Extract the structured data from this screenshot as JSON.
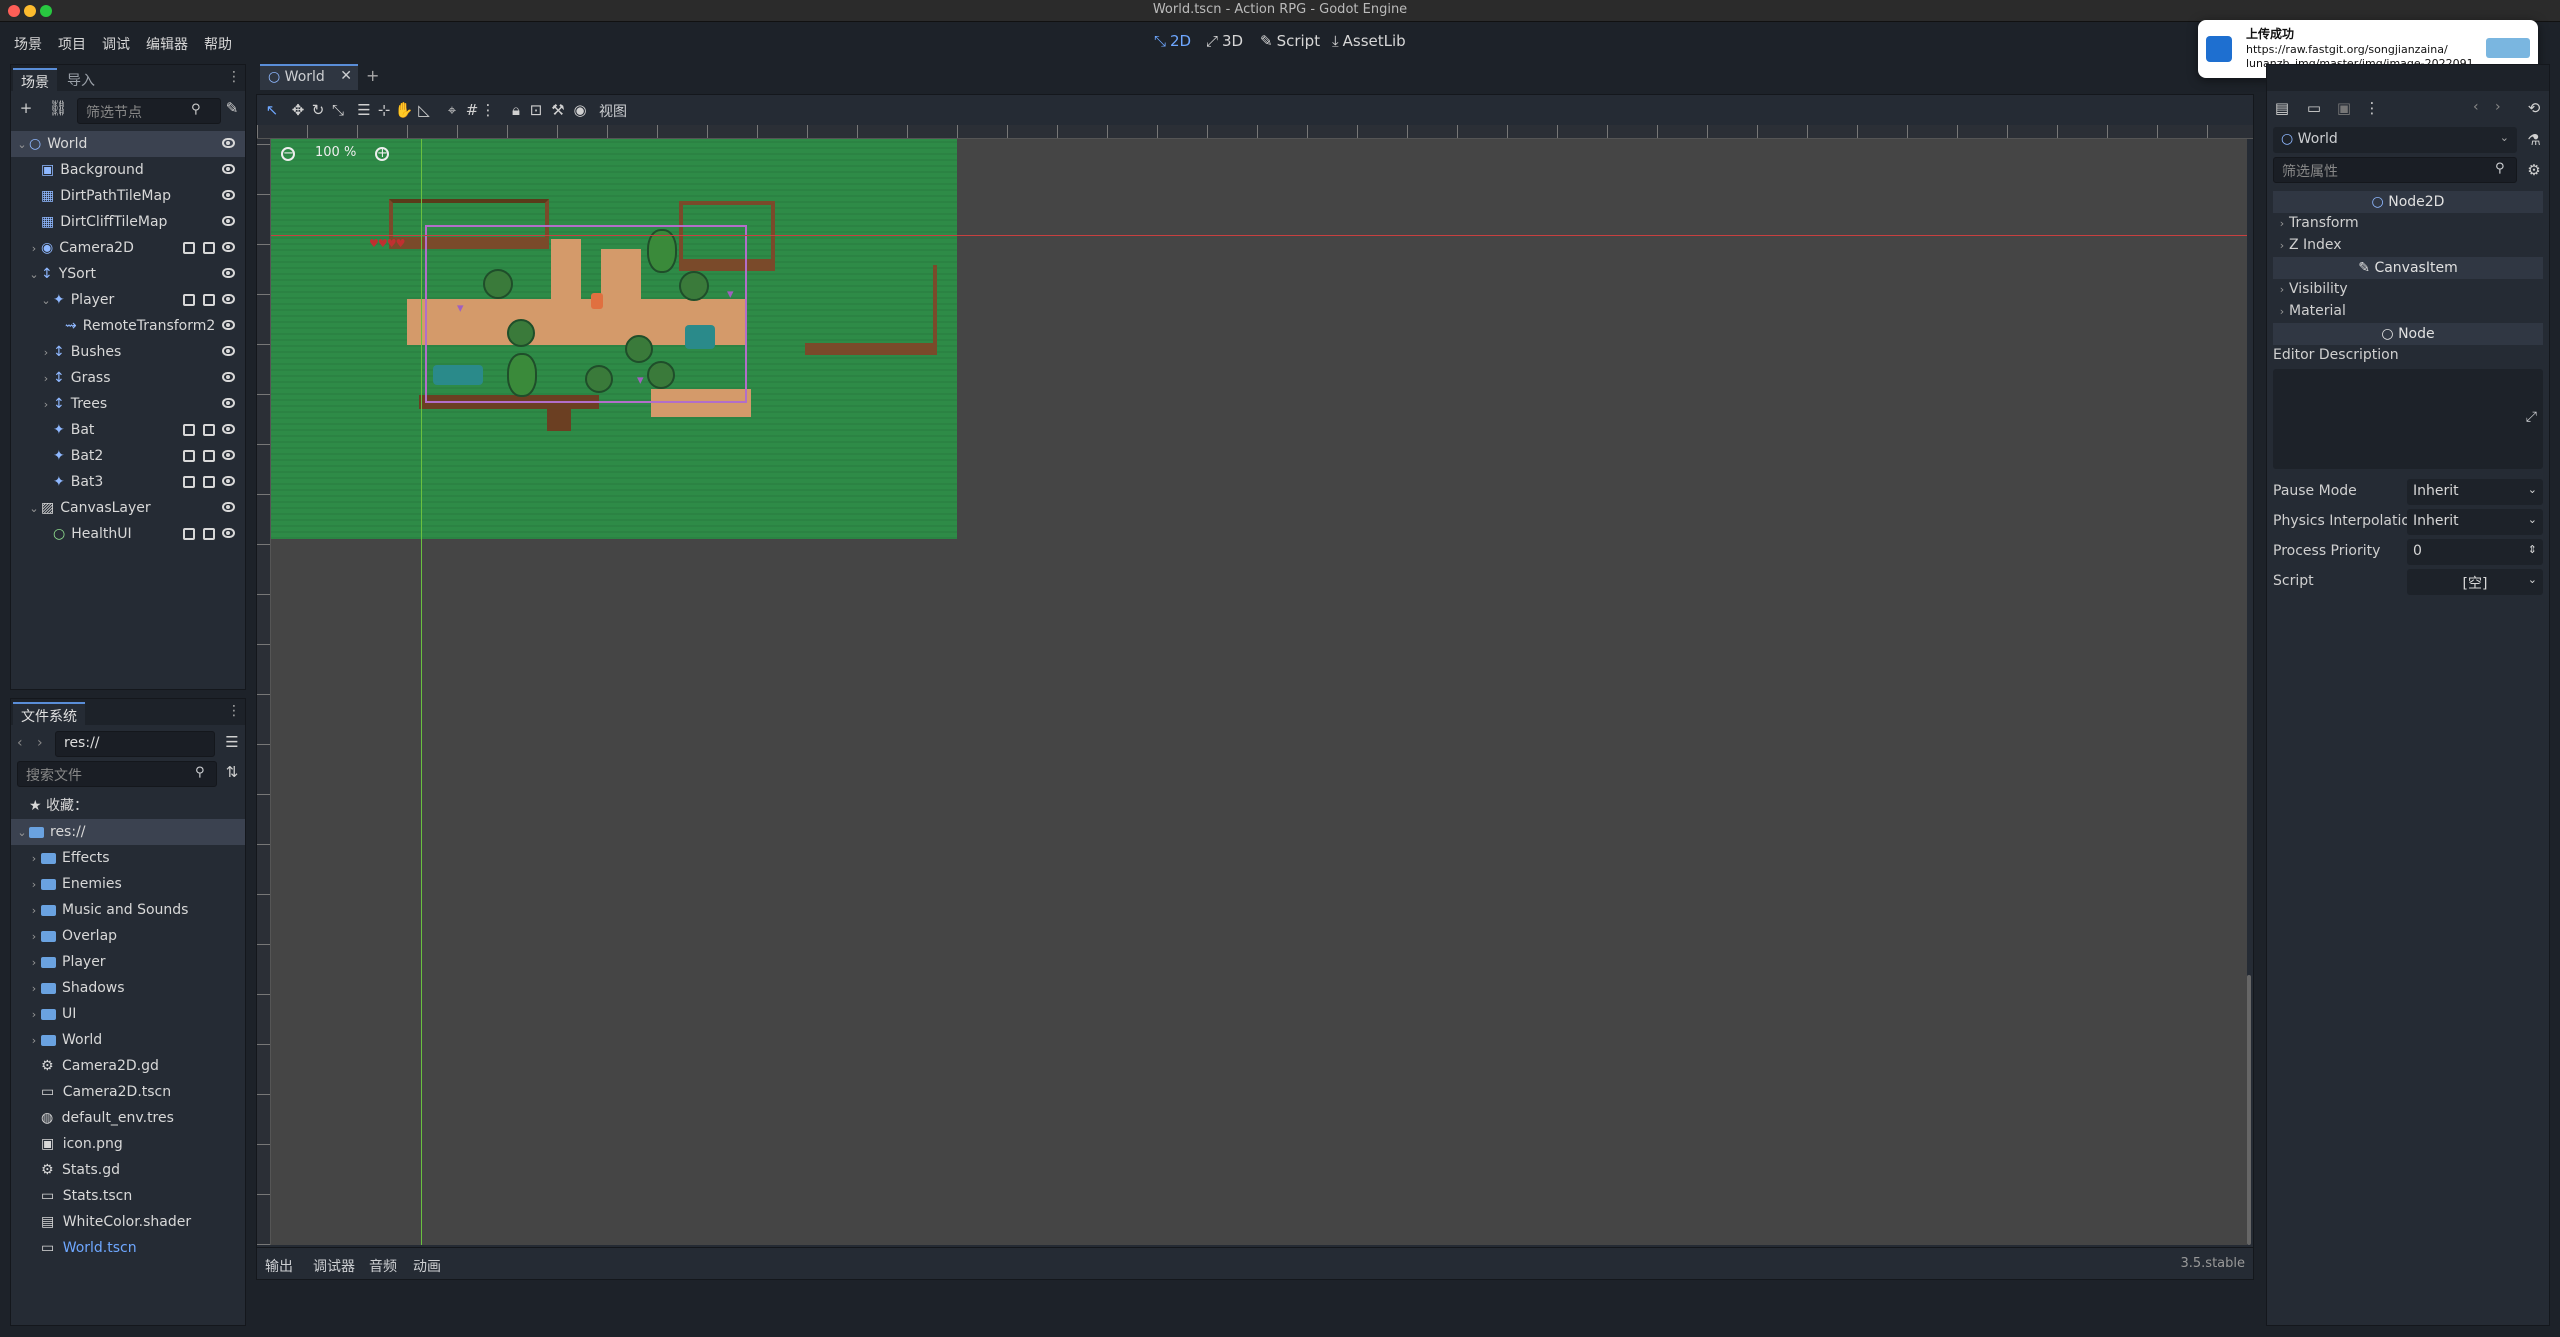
{
  "window": {
    "title": "World.tscn - Action RPG - Godot Engine"
  },
  "menu": [
    "场景",
    "项目",
    "调试",
    "编辑器",
    "帮助"
  ],
  "workspaces": [
    {
      "label": "2D",
      "active": true
    },
    {
      "label": "3D",
      "active": false
    },
    {
      "label": "Script",
      "active": false
    },
    {
      "label": "AssetLib",
      "active": false
    }
  ],
  "notification": {
    "title": "上传成功",
    "line1": "https://raw.fastgit.org/songjianzaina/",
    "line2": "lunanzb_img/master/img/image-2022091..."
  },
  "scene_dock": {
    "tabs": [
      "场景",
      "导入"
    ],
    "filter_placeholder": "筛选节点",
    "nodes": [
      {
        "label": "World",
        "depth": 0,
        "arrow": "v",
        "icon": "node2d",
        "selected": true
      },
      {
        "label": "Background",
        "depth": 1,
        "arrow": "",
        "icon": "sprite"
      },
      {
        "label": "DirtPathTileMap",
        "depth": 1,
        "arrow": "",
        "icon": "tilemap"
      },
      {
        "label": "DirtCliffTileMap",
        "depth": 1,
        "arrow": "",
        "icon": "tilemap"
      },
      {
        "label": "Camera2D",
        "depth": 1,
        "arrow": ">",
        "icon": "camera",
        "extras": 2
      },
      {
        "label": "YSort",
        "depth": 1,
        "arrow": "v",
        "icon": "ysort"
      },
      {
        "label": "Player",
        "depth": 2,
        "arrow": "v",
        "icon": "body",
        "extras": 2
      },
      {
        "label": "RemoteTransform2",
        "depth": 3,
        "arrow": "",
        "icon": "remote"
      },
      {
        "label": "Bushes",
        "depth": 2,
        "arrow": ">",
        "icon": "ysort"
      },
      {
        "label": "Grass",
        "depth": 2,
        "arrow": ">",
        "icon": "ysort"
      },
      {
        "label": "Trees",
        "depth": 2,
        "arrow": ">",
        "icon": "ysort"
      },
      {
        "label": "Bat",
        "depth": 2,
        "arrow": "",
        "icon": "body",
        "extras": 2
      },
      {
        "label": "Bat2",
        "depth": 2,
        "arrow": "",
        "icon": "body",
        "extras": 2
      },
      {
        "label": "Bat3",
        "depth": 2,
        "arrow": "",
        "icon": "body",
        "extras": 2
      },
      {
        "label": "CanvasLayer",
        "depth": 1,
        "arrow": "v",
        "icon": "canvas"
      },
      {
        "label": "HealthUI",
        "depth": 2,
        "arrow": "",
        "icon": "control",
        "extras": 2
      }
    ]
  },
  "filesystem_dock": {
    "title": "文件系统",
    "path": "res://",
    "search_placeholder": "搜索文件",
    "entries": [
      {
        "label": "收藏：",
        "type": "favorites",
        "depth": 0
      },
      {
        "label": "res://",
        "type": "folder",
        "depth": 0,
        "selected": true,
        "arrow": "v"
      },
      {
        "label": "Effects",
        "type": "folder",
        "depth": 1,
        "arrow": ">"
      },
      {
        "label": "Enemies",
        "type": "folder",
        "depth": 1,
        "arrow": ">"
      },
      {
        "label": "Music and Sounds",
        "type": "folder",
        "depth": 1,
        "arrow": ">"
      },
      {
        "label": "Overlap",
        "type": "folder",
        "depth": 1,
        "arrow": ">"
      },
      {
        "label": "Player",
        "type": "folder",
        "depth": 1,
        "arrow": ">"
      },
      {
        "label": "Shadows",
        "type": "folder",
        "depth": 1,
        "arrow": ">"
      },
      {
        "label": "UI",
        "type": "folder",
        "depth": 1,
        "arrow": ">"
      },
      {
        "label": "World",
        "type": "folder",
        "depth": 1,
        "arrow": ">"
      },
      {
        "label": "Camera2D.gd",
        "type": "script",
        "depth": 1
      },
      {
        "label": "Camera2D.tscn",
        "type": "scene",
        "depth": 1
      },
      {
        "label": "default_env.tres",
        "type": "resource",
        "depth": 1
      },
      {
        "label": "icon.png",
        "type": "image",
        "depth": 1
      },
      {
        "label": "Stats.gd",
        "type": "script",
        "depth": 1
      },
      {
        "label": "Stats.tscn",
        "type": "scene",
        "depth": 1
      },
      {
        "label": "WhiteColor.shader",
        "type": "shader",
        "depth": 1
      },
      {
        "label": "World.tscn",
        "type": "scene",
        "depth": 1,
        "highlight": true
      }
    ]
  },
  "editor": {
    "scene_tab": "World",
    "view_menu": "视图",
    "zoom": "100 %",
    "bottom_tabs": [
      "输出",
      "调试器",
      "音频",
      "动画"
    ],
    "version": "3.5.stable"
  },
  "inspector": {
    "node_name": "World",
    "filter_placeholder": "筛选属性",
    "sections": [
      {
        "header": "Node2D",
        "items": [
          "Transform",
          "Z Index"
        ]
      },
      {
        "header": "CanvasItem",
        "items": [
          "Visibility",
          "Material"
        ]
      },
      {
        "header": "Node",
        "items": []
      }
    ],
    "editor_description": "Editor Description",
    "props": [
      {
        "label": "Pause Mode",
        "value": "Inherit",
        "kind": "dropdown"
      },
      {
        "label": "Physics Interpolatio",
        "value": "Inherit",
        "kind": "dropdown"
      },
      {
        "label": "Process Priority",
        "value": "0",
        "kind": "spin"
      },
      {
        "label": "Script",
        "value": "[空]",
        "kind": "dropdown"
      }
    ]
  },
  "colors": {
    "accent": "#6ea7ff",
    "panel": "#252b34",
    "bg": "#1d2229",
    "viewport": "#454545",
    "grass": "#2e8b47",
    "dirt": "#d49a6a"
  }
}
